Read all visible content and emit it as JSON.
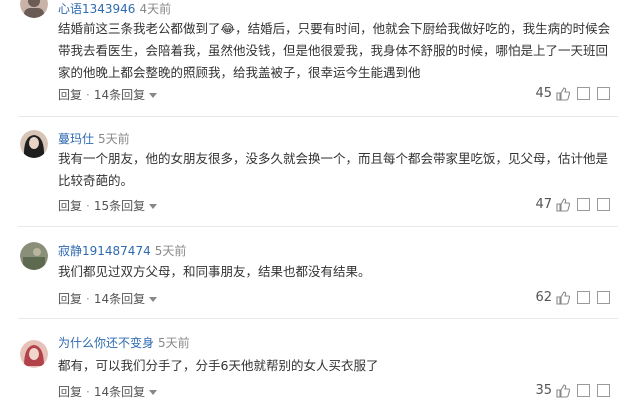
{
  "comments": [
    {
      "name": "心语1343946",
      "time": "4天前",
      "lines": [
        "结婚前这三条我老公都做到了😂，结婚后，只要有时间，他就会下厨给我做好吃的，我生病的时候会",
        "带我去看医生，会陪着我，虽然他没钱，但是他很爱我，我身体不舒服的时候，哪怕是上了一天班回",
        "家的他晚上都会整晚的照顾我，给我盖被子，很幸运今生能遇到他"
      ],
      "reply_label": "回复",
      "replies_label": "14条回复",
      "likes": "45",
      "avatar_colors": [
        "#6b5b55",
        "#c9b3a8"
      ]
    },
    {
      "name": "蔓玛仕",
      "time": "5天前",
      "lines": [
        "我有一个朋友，他的女朋友很多，没多久就会换一个，而且每个都会带家里吃饭，见父母，估计他是",
        "比较奇葩的。"
      ],
      "reply_label": "回复",
      "replies_label": "15条回复",
      "likes": "47",
      "avatar_colors": [
        "#1e1e1e",
        "#d8c4b6"
      ]
    },
    {
      "name": "寂静191487474",
      "time": "5天前",
      "lines": [
        "我们都见过双方父母，和同事朋友，结果也都没有结果。"
      ],
      "reply_label": "回复",
      "replies_label": "14条回复",
      "likes": "62",
      "avatar_colors": [
        "#8a8f7a",
        "#5d6a4f"
      ]
    },
    {
      "name": "为什么你还不变身",
      "time": "5天前",
      "lines": [
        "都有，可以我们分手了，分手6天他就帮别的女人买衣服了"
      ],
      "reply_label": "回复",
      "replies_label": "14条回复",
      "likes": "35",
      "avatar_colors": [
        "#b2424a",
        "#e6c2b8"
      ]
    }
  ],
  "icons": {
    "like": "thumbs-up-icon",
    "share": "share-icon",
    "report": "report-icon"
  }
}
